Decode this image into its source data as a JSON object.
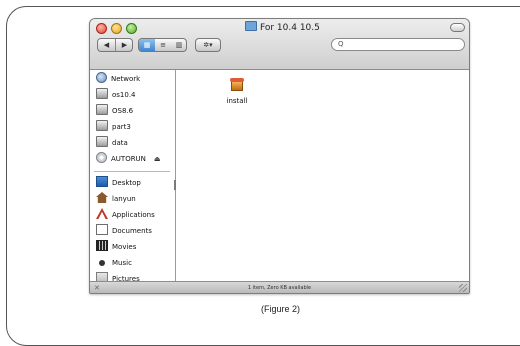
{
  "window": {
    "title": "For 10.4 10.5",
    "search_placeholder": "Q"
  },
  "toolbar": {
    "back": "◀",
    "forward": "▶",
    "view_icon": "▦",
    "view_list": "≡",
    "view_column": "▥",
    "action": "✲▾"
  },
  "sidebar": {
    "items": [
      {
        "label": "Network",
        "icon": "network-icon"
      },
      {
        "label": "os10.4",
        "icon": "disk-icon"
      },
      {
        "label": "OS8.6",
        "icon": "disk-icon"
      },
      {
        "label": "part3",
        "icon": "disk-icon"
      },
      {
        "label": "data",
        "icon": "disk-icon"
      },
      {
        "label": "AUTORUN",
        "icon": "cd-icon"
      },
      {
        "label": "Desktop",
        "icon": "desktop-icon"
      },
      {
        "label": "lanyun",
        "icon": "home-icon"
      },
      {
        "label": "Applications",
        "icon": "applications-icon"
      },
      {
        "label": "Documents",
        "icon": "documents-icon"
      },
      {
        "label": "Movies",
        "icon": "movies-icon"
      },
      {
        "label": "Music",
        "icon": "music-icon"
      },
      {
        "label": "Pictures",
        "icon": "pictures-icon"
      }
    ],
    "eject": "⏏"
  },
  "content": {
    "file_label": "install"
  },
  "status": {
    "text": "1 item, Zero KB available",
    "tool": "✕"
  },
  "caption": "(Figure 2)"
}
